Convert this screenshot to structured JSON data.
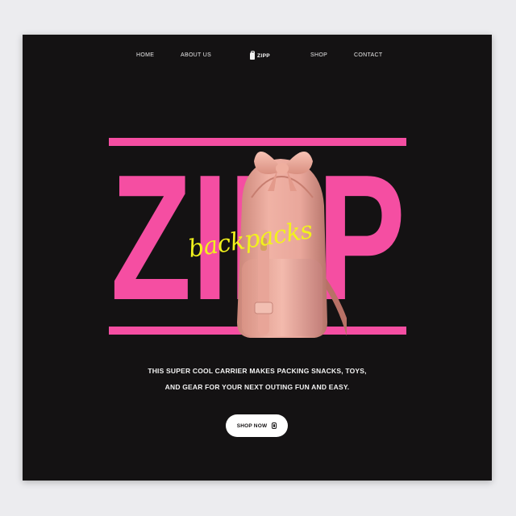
{
  "nav": {
    "home": "HOME",
    "about": "ABOUT US",
    "logo_text": "ZIPP",
    "logo_icon": "backpack-icon",
    "shop": "SHOP",
    "contact": "CONTACT"
  },
  "hero": {
    "big_word": "ZIPP",
    "script_word": "backpacks",
    "tagline_line1": "THIS SUPER COOL CARRIER MAKES PACKING SNACKS, TOYS,",
    "tagline_line2": "AND GEAR FOR YOUR NEXT OUTING FUN AND EASY.",
    "cta_label": "SHOP NOW",
    "cta_icon": "backpack-icon"
  },
  "colors": {
    "background": "#141213",
    "accent_pink": "#f54ea2",
    "script_yellow": "#f2f21c",
    "backpack_peach": "#e9a79b"
  }
}
